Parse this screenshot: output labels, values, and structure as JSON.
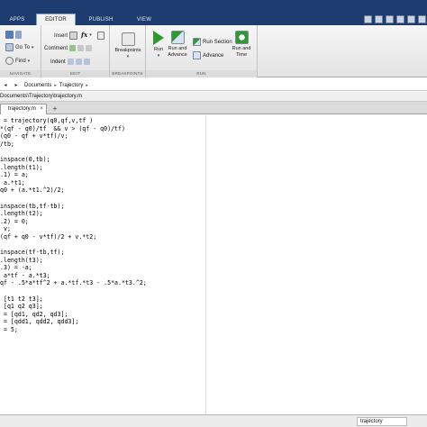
{
  "ribbon_tabs": {
    "apps": "APPS",
    "editor": "EDITOR",
    "publish": "PUBLISH",
    "view": "VIEW"
  },
  "navigate": {
    "goto": "Go To",
    "find": "Find",
    "footer": "NAVIGATE"
  },
  "edit": {
    "insert": "Insert",
    "fx": "fx",
    "comment": "Comment",
    "indent": "Indent",
    "footer": "EDIT"
  },
  "breakpoints": {
    "label": "Breakpoints",
    "footer": "BREAKPOINTS"
  },
  "run": {
    "run": "Run",
    "run_and_advance": [
      "Run and",
      "Advance"
    ],
    "run_section": "Run Section",
    "advance": "Advance",
    "run_and_time": [
      "Run and",
      "Time"
    ],
    "footer": "RUN"
  },
  "address": {
    "segments": [
      "Documents",
      "Trajectory"
    ]
  },
  "path": "Documents\\Trajectory\\trajectory.m",
  "editor_tab": {
    "filename": "trajectory.m",
    "close": "×",
    "new_tab": "+"
  },
  "code_lines": [
    " = trajectory(q0,qf,v,tf )",
    "*(qf - q0)/tf  && v > (qf - q0)/tf)",
    "(q0 - qf + v*tf)/v;",
    "/tb;",
    "",
    "inspace(0,tb);",
    ".length(t1);",
    ".1) = a;",
    " a.*t1;",
    "q0 + (a.*t1.^2)/2;",
    "",
    "inspace(tb,tf-tb);",
    ".length(t2);",
    ".2) = 0;",
    " v;",
    "(qf + q0 - v*tf)/2 + v.*t2;",
    "",
    "inspace(tf-tb,tf);",
    ".length(t3);",
    ".3) = -a;",
    " a*tf - a.*t3;",
    "qf - .5*a*tf^2 + a.*tf.*t3 - .5*a.*t3.^2;",
    "",
    " [t1 t2 t3];",
    " [q1 q2 q3];",
    " = [qd1, qd2, qd3];",
    " = [qdd1, qdd2, qdd3];",
    " = 5;"
  ],
  "status": {
    "function_name": "trajectory"
  },
  "colors": {
    "tab_strip": "#1c3b6e",
    "run_green": "#2e9a2e"
  }
}
